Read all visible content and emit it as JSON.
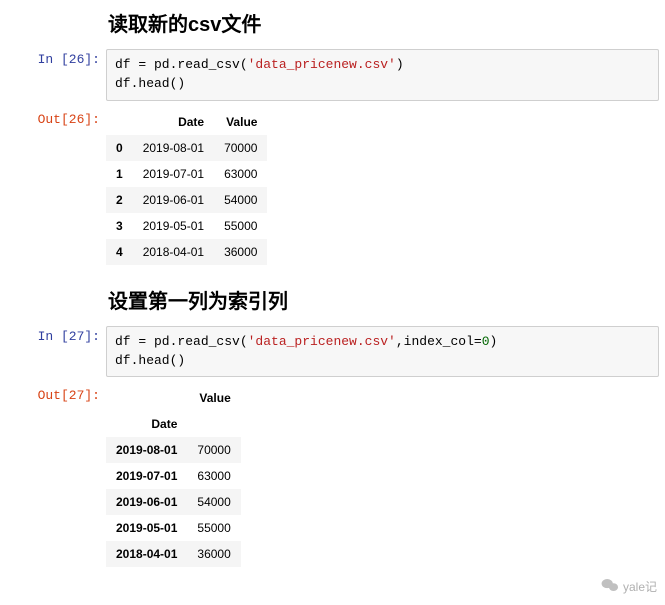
{
  "sections": [
    {
      "heading": "读取新的csv文件",
      "in_prompt": "In [26]:",
      "out_prompt": "Out[26]:",
      "code_prefix": "df = pd.read_csv(",
      "code_str": "'data_pricenew.csv'",
      "code_suffix": ")",
      "code_line2": "df.head()",
      "table": {
        "index_name": "",
        "columns": [
          "Date",
          "Value"
        ],
        "rows": [
          {
            "idx": "0",
            "cells": [
              "2019-08-01",
              "70000"
            ]
          },
          {
            "idx": "1",
            "cells": [
              "2019-07-01",
              "63000"
            ]
          },
          {
            "idx": "2",
            "cells": [
              "2019-06-01",
              "54000"
            ]
          },
          {
            "idx": "3",
            "cells": [
              "2019-05-01",
              "55000"
            ]
          },
          {
            "idx": "4",
            "cells": [
              "2018-04-01",
              "36000"
            ]
          }
        ]
      }
    },
    {
      "heading": "设置第一列为索引列",
      "in_prompt": "In [27]:",
      "out_prompt": "Out[27]:",
      "code_prefix": "df = pd.read_csv(",
      "code_str": "'data_pricenew.csv'",
      "code_mid": ",index_col=",
      "code_num": "0",
      "code_suffix": ")",
      "code_line2": "df.head()",
      "table": {
        "index_name": "Date",
        "columns": [
          "Value"
        ],
        "rows": [
          {
            "idx": "2019-08-01",
            "cells": [
              "70000"
            ]
          },
          {
            "idx": "2019-07-01",
            "cells": [
              "63000"
            ]
          },
          {
            "idx": "2019-06-01",
            "cells": [
              "54000"
            ]
          },
          {
            "idx": "2019-05-01",
            "cells": [
              "55000"
            ]
          },
          {
            "idx": "2018-04-01",
            "cells": [
              "36000"
            ]
          }
        ]
      }
    }
  ],
  "watermark": "yale记"
}
